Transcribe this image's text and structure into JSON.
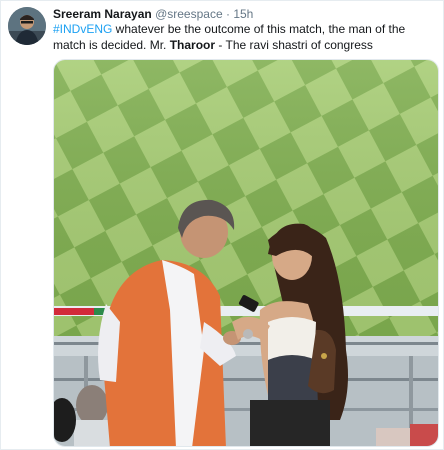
{
  "tweet": {
    "display_name": "Sreeram Narayan",
    "handle": "@sreespace",
    "separator": "·",
    "time": "15h",
    "hashtag": "#INDvENG",
    "text_part1": " whatever be the outcome of this match, the man of the match is decided. Mr. ",
    "text_bold": "Tharoor",
    "text_part2": " - The ravi shastri of congress"
  },
  "media": {
    "photo_description_icon": "photo-icon"
  },
  "colors": {
    "link": "#1da1f2",
    "secondary_text": "#657786",
    "pitch_light": "#9cc46a",
    "pitch_dark": "#79a64a"
  }
}
